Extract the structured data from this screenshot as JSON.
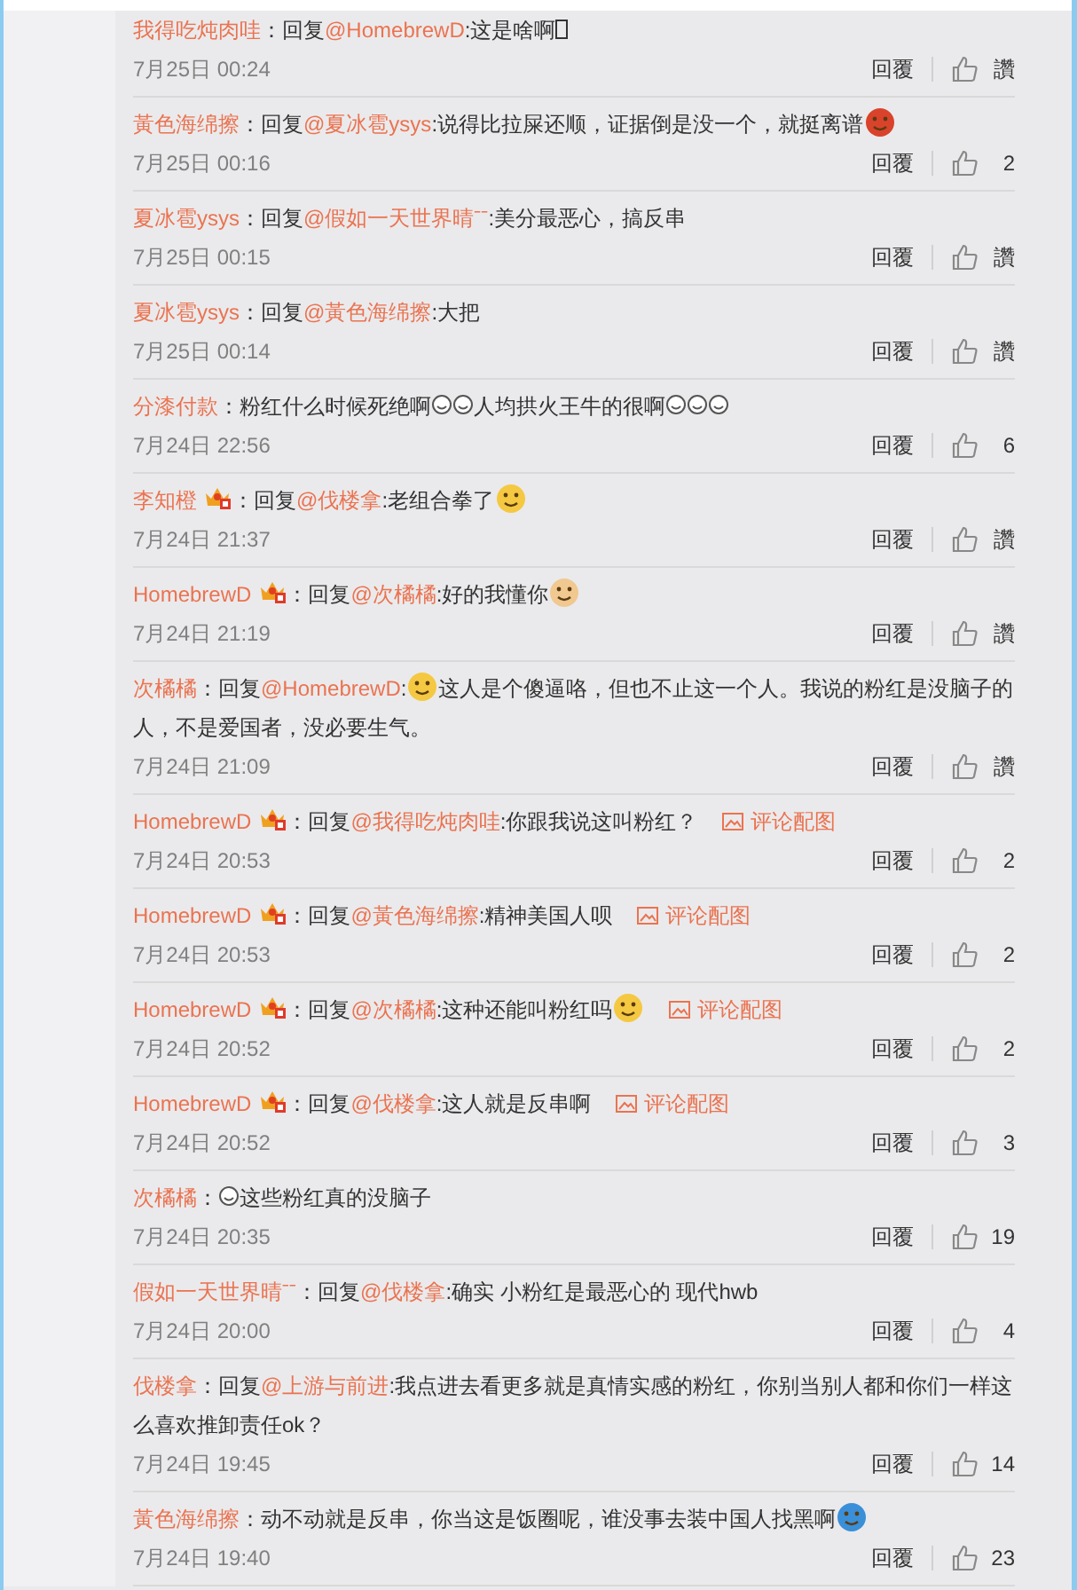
{
  "comments": [
    {
      "user": "我得吃炖肉哇",
      "badge": false,
      "parts": [
        {
          "kind": "text",
          "text": "：回复"
        },
        {
          "kind": "mention",
          "text": "@HomebrewD"
        },
        {
          "kind": "text",
          "text": ":这是啥啊"
        },
        {
          "kind": "tofu"
        }
      ],
      "date": "7月25日 00:24",
      "reply": "回覆",
      "likes": "讚"
    },
    {
      "user": "黃色海绵擦",
      "badge": false,
      "parts": [
        {
          "kind": "text",
          "text": "：回复"
        },
        {
          "kind": "mention",
          "text": "@夏冰雹ysys"
        },
        {
          "kind": "text",
          "text": ":说得比拉屎还顺，证据倒是没一个，就挺离谱"
        },
        {
          "kind": "emoji",
          "color": "#d9432b"
        }
      ],
      "date": "7月25日 00:16",
      "reply": "回覆",
      "likes": "2"
    },
    {
      "user": "夏冰雹ysys",
      "badge": false,
      "parts": [
        {
          "kind": "text",
          "text": "：回复"
        },
        {
          "kind": "mention",
          "text": "@假如一天世界晴ˉˉ"
        },
        {
          "kind": "text",
          "text": ":美分最恶心，搞反串"
        }
      ],
      "date": "7月25日 00:15",
      "reply": "回覆",
      "likes": "讚"
    },
    {
      "user": "夏冰雹ysys",
      "badge": false,
      "parts": [
        {
          "kind": "text",
          "text": "：回复"
        },
        {
          "kind": "mention",
          "text": "@黃色海绵擦"
        },
        {
          "kind": "text",
          "text": ":大把"
        }
      ],
      "date": "7月25日 00:14",
      "reply": "回覆",
      "likes": "讚"
    },
    {
      "user": "分漆付款",
      "badge": false,
      "parts": [
        {
          "kind": "text",
          "text": "：粉红什么时候死绝啊"
        },
        {
          "kind": "small_emoji"
        },
        {
          "kind": "small_emoji"
        },
        {
          "kind": "text",
          "text": "人均拱火王牛的很啊"
        },
        {
          "kind": "small_emoji"
        },
        {
          "kind": "small_emoji"
        },
        {
          "kind": "small_emoji"
        }
      ],
      "date": "7月24日 22:56",
      "reply": "回覆",
      "likes": "6"
    },
    {
      "user": "李知橙",
      "badge": true,
      "parts": [
        {
          "kind": "text",
          "text": "：回复"
        },
        {
          "kind": "mention",
          "text": "@伐楼拿"
        },
        {
          "kind": "text",
          "text": ":老组合拳了"
        },
        {
          "kind": "emoji",
          "color": "#f5c842"
        }
      ],
      "date": "7月24日 21:37",
      "reply": "回覆",
      "likes": "讚"
    },
    {
      "user": "HomebrewD",
      "badge": true,
      "parts": [
        {
          "kind": "text",
          "text": "：回复"
        },
        {
          "kind": "mention",
          "text": "@次橘橘"
        },
        {
          "kind": "text",
          "text": ":好的我懂你"
        },
        {
          "kind": "emoji",
          "color": "#f0c890"
        }
      ],
      "date": "7月24日 21:19",
      "reply": "回覆",
      "likes": "讚"
    },
    {
      "user": "次橘橘",
      "badge": false,
      "parts": [
        {
          "kind": "text",
          "text": "：回复"
        },
        {
          "kind": "mention",
          "text": "@HomebrewD"
        },
        {
          "kind": "text",
          "text": ":"
        },
        {
          "kind": "emoji",
          "color": "#f5c842"
        },
        {
          "kind": "text",
          "text": "这人是个傻逼咯，但也不止这一个人。我说的粉红是没脑子的人，不是爱国者，没必要生气。"
        }
      ],
      "date": "7月24日 21:09",
      "reply": "回覆",
      "likes": "讚"
    },
    {
      "user": "HomebrewD",
      "badge": true,
      "parts": [
        {
          "kind": "text",
          "text": "：回复"
        },
        {
          "kind": "mention",
          "text": "@我得吃炖肉哇"
        },
        {
          "kind": "text",
          "text": ":你跟我说这叫粉红？"
        }
      ],
      "image_link": "评论配图",
      "date": "7月24日 20:53",
      "reply": "回覆",
      "likes": "2"
    },
    {
      "user": "HomebrewD",
      "badge": true,
      "parts": [
        {
          "kind": "text",
          "text": "：回复"
        },
        {
          "kind": "mention",
          "text": "@黃色海绵擦"
        },
        {
          "kind": "text",
          "text": ":精神美国人呗"
        }
      ],
      "image_link": "评论配图",
      "date": "7月24日 20:53",
      "reply": "回覆",
      "likes": "2"
    },
    {
      "user": "HomebrewD",
      "badge": true,
      "parts": [
        {
          "kind": "text",
          "text": "：回复"
        },
        {
          "kind": "mention",
          "text": "@次橘橘"
        },
        {
          "kind": "text",
          "text": ":这种还能叫粉红吗"
        },
        {
          "kind": "emoji",
          "color": "#f5c842"
        }
      ],
      "image_link": "评论配图",
      "date": "7月24日 20:52",
      "reply": "回覆",
      "likes": "2"
    },
    {
      "user": "HomebrewD",
      "badge": true,
      "parts": [
        {
          "kind": "text",
          "text": "：回复"
        },
        {
          "kind": "mention",
          "text": "@伐楼拿"
        },
        {
          "kind": "text",
          "text": ":这人就是反串啊"
        }
      ],
      "image_link": "评论配图",
      "date": "7月24日 20:52",
      "reply": "回覆",
      "likes": "3"
    },
    {
      "user": "次橘橘",
      "badge": false,
      "parts": [
        {
          "kind": "text",
          "text": "："
        },
        {
          "kind": "small_emoji"
        },
        {
          "kind": "text",
          "text": "这些粉红真的没脑子"
        }
      ],
      "date": "7月24日 20:35",
      "reply": "回覆",
      "likes": "19"
    },
    {
      "user": "假如一天世界晴ˉˉ",
      "badge": false,
      "parts": [
        {
          "kind": "text",
          "text": "：回复"
        },
        {
          "kind": "mention",
          "text": "@伐楼拿"
        },
        {
          "kind": "text",
          "text": ":确实 小粉红是最恶心的  现代hwb"
        }
      ],
      "date": "7月24日 20:00",
      "reply": "回覆",
      "likes": "4"
    },
    {
      "user": "伐楼拿",
      "badge": false,
      "parts": [
        {
          "kind": "text",
          "text": "：回复"
        },
        {
          "kind": "mention",
          "text": "@上游与前进"
        },
        {
          "kind": "text",
          "text": ":我点进去看更多就是真情实感的粉红，你别当别人都和你们一样这么喜欢推卸责任ok？"
        }
      ],
      "date": "7月24日 19:45",
      "reply": "回覆",
      "likes": "14"
    },
    {
      "user": "黃色海绵擦",
      "badge": false,
      "parts": [
        {
          "kind": "text",
          "text": "：动不动就是反串，你当这是饭圈呢，谁没事去装中国人找黑啊"
        },
        {
          "kind": "emoji",
          "color": "#3a8fd8"
        }
      ],
      "date": "7月24日 19:40",
      "reply": "回覆",
      "likes": "23"
    }
  ]
}
